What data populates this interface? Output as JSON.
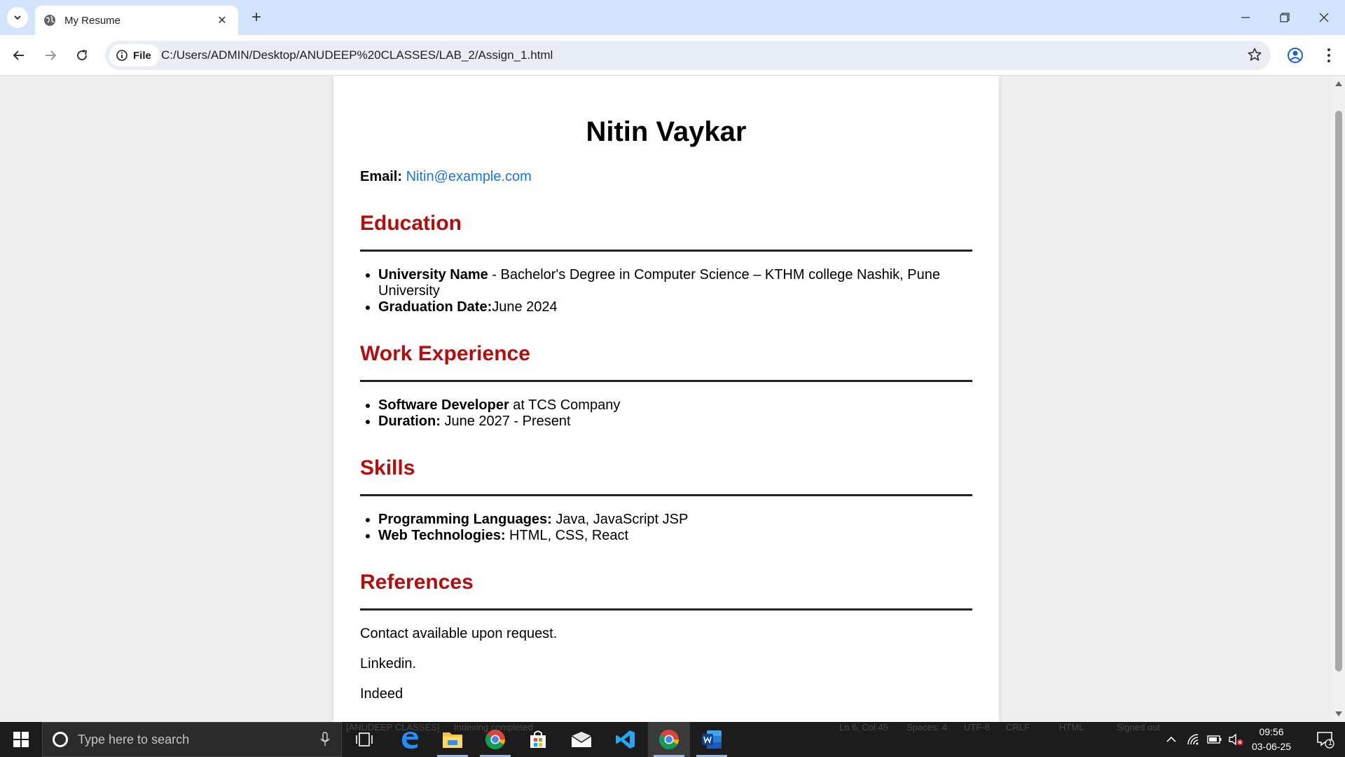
{
  "browser": {
    "tab_title": "My Resume",
    "chip_label": "File",
    "url": "C:/Users/ADMIN/Desktop/ANUDEEP%20CLASSES/LAB_2/Assign_1.html"
  },
  "resume": {
    "name": "Nitin Vaykar",
    "email_label": "Email:",
    "email": "Nitin@example.com",
    "education": {
      "title": "Education",
      "items": [
        {
          "bold": "University Name",
          "text": " - Bachelor's Degree in Computer Science – KTHM college Nashik, Pune University"
        },
        {
          "bold": "Graduation Date:",
          "text": "June 2024"
        }
      ]
    },
    "work": {
      "title": "Work Experience",
      "items": [
        {
          "bold": "Software Developer",
          "text": " at TCS Company"
        },
        {
          "bold": "Duration:",
          "text": " June 2027 - Present"
        }
      ]
    },
    "skills": {
      "title": "Skills",
      "items": [
        {
          "bold": "Programming Languages:",
          "text": " Java, JavaScript JSP"
        },
        {
          "bold": "Web Technologies:",
          "text": " HTML, CSS, React"
        }
      ]
    },
    "references": {
      "title": "References",
      "lines": [
        "Contact available upon request.",
        "Linkedin.",
        "Indeed"
      ]
    }
  },
  "taskbar": {
    "search_placeholder": "Type here to search",
    "background_status": {
      "workspace": "[ANUDEEP CLASSES]",
      "indexing": "Indexing completed",
      "cursor": "Ln 6, Col 45",
      "spaces": "Spaces: 4",
      "encoding": "UTF-8",
      "eol": "CRLF",
      "language": "HTML",
      "account": "Signed out"
    },
    "time": "09:56",
    "date": "03-06-25",
    "notification_count": "1"
  },
  "colors": {
    "accent_heading": "#b30e0e",
    "link": "#1a73e8",
    "tabbar": "#d3e3fd",
    "taskbar": "#1c1c1c"
  },
  "icons": [
    "tab-list-icon",
    "globe-icon",
    "close-icon",
    "plus-icon",
    "minimize-icon",
    "restore-icon",
    "back-icon",
    "forward-icon",
    "reload-icon",
    "info-icon",
    "star-icon",
    "profile-icon",
    "menu-icon",
    "windows-icon",
    "search-icon",
    "mic-icon",
    "task-view-icon",
    "edge-icon",
    "file-explorer-icon",
    "chrome-icon",
    "store-icon",
    "mail-icon",
    "vscode-icon",
    "word-icon",
    "chevron-up-icon",
    "wifi-icon",
    "battery-icon",
    "volume-muted-icon",
    "notification-icon"
  ]
}
